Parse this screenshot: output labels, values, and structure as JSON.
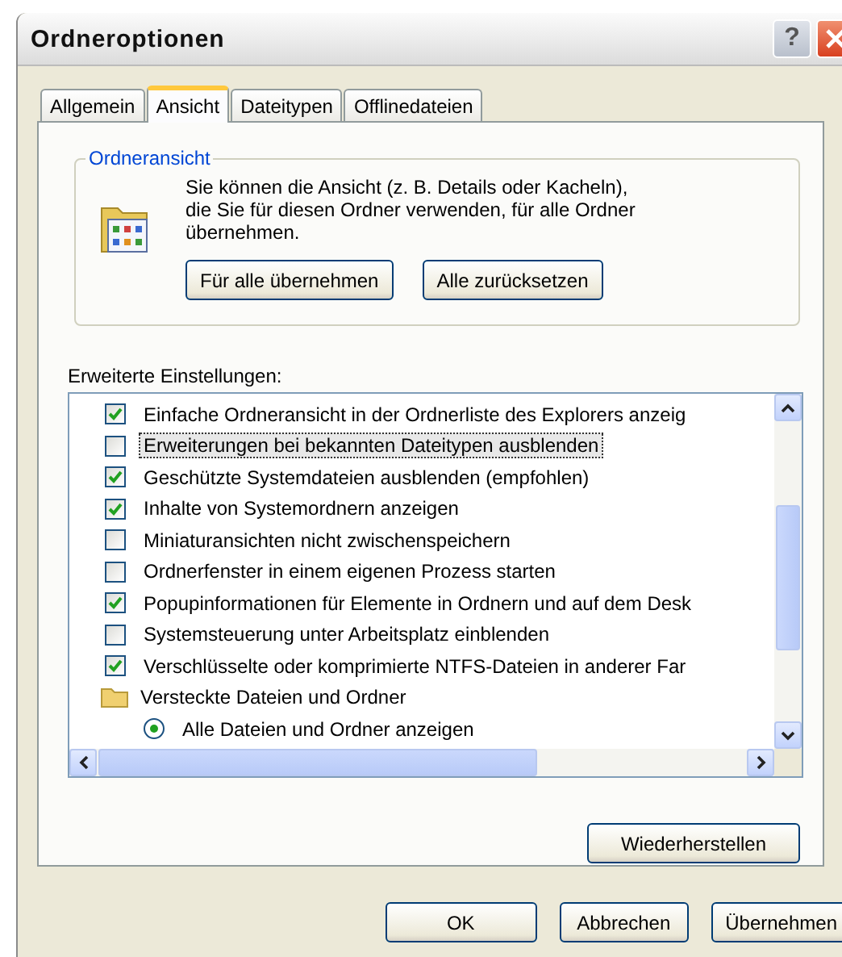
{
  "window": {
    "title": "Ordneroptionen",
    "help": "?"
  },
  "tabs": [
    {
      "label": "Allgemein",
      "selected": false
    },
    {
      "label": "Ansicht",
      "selected": true
    },
    {
      "label": "Dateitypen",
      "selected": false
    },
    {
      "label": "Offlinedateien",
      "selected": false
    }
  ],
  "group": {
    "title": "Ordneransicht",
    "text": "Sie können die Ansicht (z. B. Details oder Kacheln), die Sie für diesen Ordner verwenden, für alle Ordner übernehmen.",
    "buttons": [
      "Für alle übernehmen",
      "Alle zurücksetzen"
    ]
  },
  "advanced": {
    "label": "Erweiterte Einstellungen:",
    "items": [
      {
        "kind": "checkbox",
        "label": "Einfache Ordneransicht in der Ordnerliste des Explorers anzeig",
        "checked": true,
        "selected": false
      },
      {
        "kind": "checkbox",
        "label": "Erweiterungen bei bekannten Dateitypen ausblenden",
        "checked": false,
        "selected": true
      },
      {
        "kind": "checkbox",
        "label": "Geschützte Systemdateien ausblenden (empfohlen)",
        "checked": true,
        "selected": false
      },
      {
        "kind": "checkbox",
        "label": "Inhalte von Systemordnern anzeigen",
        "checked": true,
        "selected": false
      },
      {
        "kind": "checkbox",
        "label": "Miniaturansichten nicht zwischenspeichern",
        "checked": false,
        "selected": false
      },
      {
        "kind": "checkbox",
        "label": "Ordnerfenster in einem eigenen Prozess starten",
        "checked": false,
        "selected": false
      },
      {
        "kind": "checkbox",
        "label": "Popupinformationen für Elemente in Ordnern und auf dem Desk",
        "checked": true,
        "selected": false
      },
      {
        "kind": "checkbox",
        "label": "Systemsteuerung unter Arbeitsplatz einblenden",
        "checked": false,
        "selected": false
      },
      {
        "kind": "checkbox",
        "label": "Verschlüsselte oder komprimierte NTFS-Dateien in anderer Far",
        "checked": true,
        "selected": false
      },
      {
        "kind": "folder",
        "label": "Versteckte Dateien und Ordner",
        "selected": false,
        "children": [
          {
            "kind": "radio",
            "label": "Alle Dateien und Ordner anzeigen",
            "checked": true,
            "selected": false
          }
        ]
      }
    ]
  },
  "restore_button": "Wiederherstellen",
  "buttons": [
    "OK",
    "Abbrechen",
    "Übernehmen"
  ]
}
